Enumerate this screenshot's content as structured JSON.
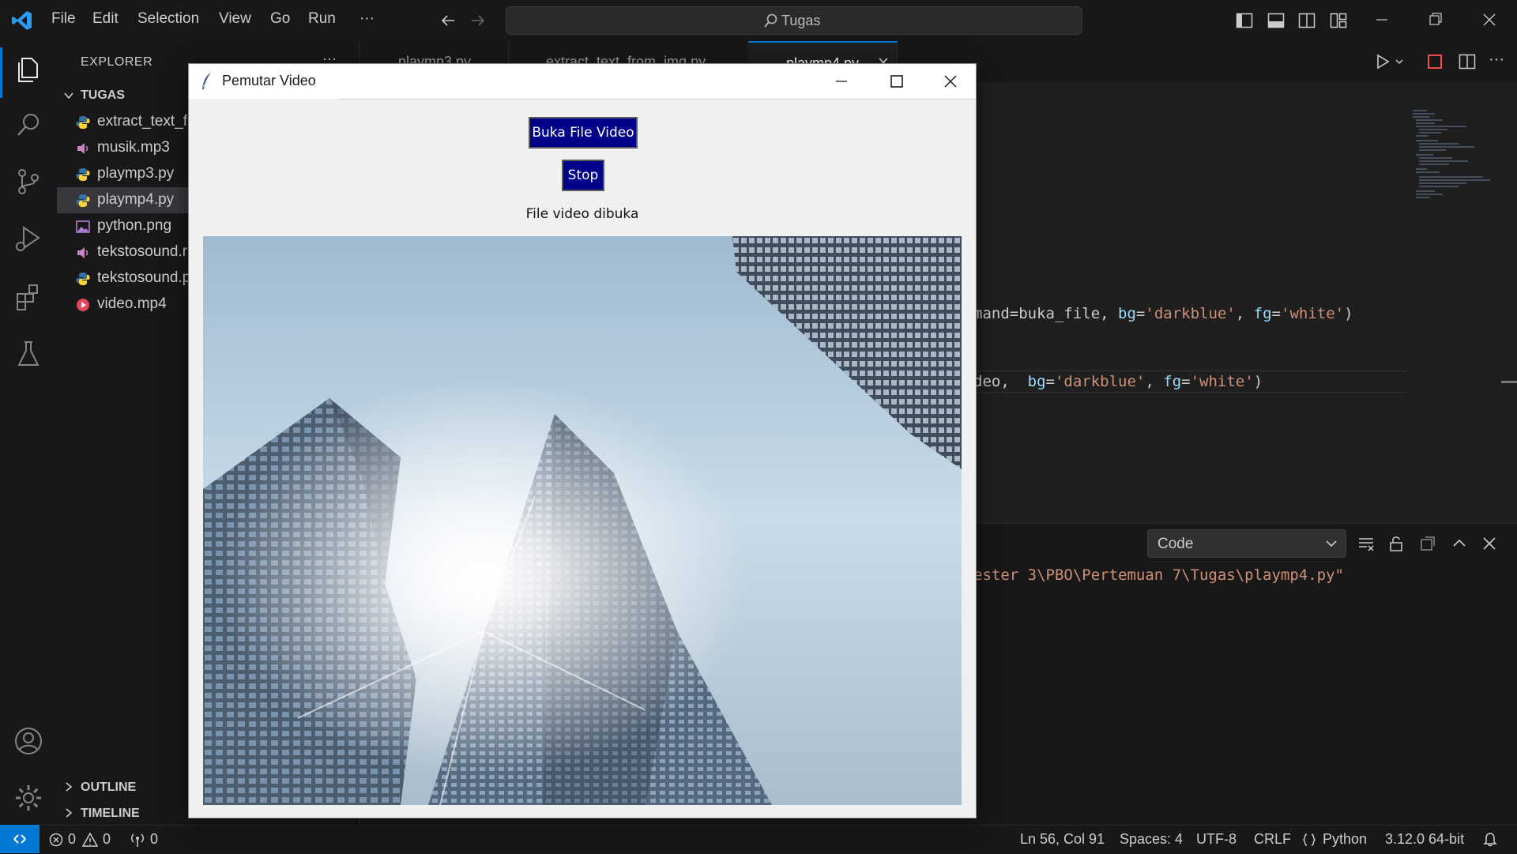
{
  "titlebar": {
    "menu": [
      "File",
      "Edit",
      "Selection",
      "View",
      "Go",
      "Run",
      "···"
    ],
    "search_label": "Tugas"
  },
  "sidebar": {
    "title": "EXPLORER",
    "more": "···",
    "folder": "TUGAS",
    "files": [
      {
        "label": "extract_text_f",
        "icon": "python-file-icon",
        "color": "#3572a5"
      },
      {
        "label": "musik.mp3",
        "icon": "audio-file-icon",
        "color": "#c586c0"
      },
      {
        "label": "playmp3.py",
        "icon": "python-file-icon",
        "color": "#3572a5"
      },
      {
        "label": "playmp4.py",
        "icon": "python-file-icon",
        "color": "#3572a5",
        "selected": true
      },
      {
        "label": "python.png",
        "icon": "image-file-icon",
        "color": "#b180d7"
      },
      {
        "label": "tekstosound.r",
        "icon": "audio-file-icon",
        "color": "#c586c0"
      },
      {
        "label": "tekstosound.p",
        "icon": "python-file-icon",
        "color": "#3572a5"
      },
      {
        "label": "video.mp4",
        "icon": "video-file-icon",
        "color": "#e0475d"
      }
    ],
    "outline": "OUTLINE",
    "timeline": "TIMELINE"
  },
  "tabs": [
    {
      "label": "playmp3.py"
    },
    {
      "label": "extract_text_from_img.py"
    },
    {
      "label": "playmp4.py",
      "active": true
    }
  ],
  "editor": {
    "line1": {
      "a": "mand=buka_file, ",
      "b": "bg",
      "c": "=",
      "d": "'darkblue'",
      "e": ", ",
      "f": "fg",
      "g": "=",
      "h": "'white'",
      "i": ")"
    },
    "line2": {
      "a": "deo,  ",
      "b": "bg",
      "c": "=",
      "d": "'darkblue'",
      "e": ", ",
      "f": "fg",
      "g": "=",
      "h": "'white'",
      "i": ")"
    }
  },
  "panel": {
    "select_value": "Code",
    "output_line": "ester 3\\PBO\\Pertemuan 7\\Tugas\\playmp4.py\""
  },
  "statusbar": {
    "errors": "0",
    "warnings": "0",
    "ports": "0",
    "position": "Ln 56, Col 91",
    "spaces": "Spaces: 4",
    "encoding": "UTF-8",
    "eol": "CRLF",
    "language": "Python",
    "interpreter": "3.12.0 64-bit"
  },
  "tk_window": {
    "title": "Pemutar Video",
    "open_button": "Buka File Video",
    "stop_button": "Stop",
    "status": "File video dibuka"
  },
  "colors": {
    "accent": "#0078d4",
    "button_bg": "#00008b",
    "string": "#ce9178",
    "keyword": "#9cdcfe"
  }
}
